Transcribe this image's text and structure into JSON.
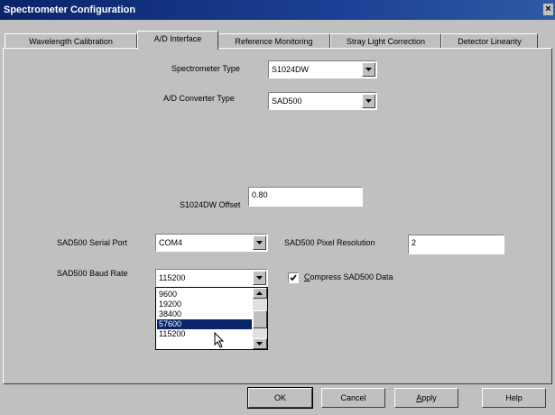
{
  "window": {
    "title": "Spectrometer Configuration",
    "close_glyph": "×"
  },
  "tabs": [
    {
      "label": "Wavelength Calibration",
      "active": false
    },
    {
      "label": "A/D Interface",
      "active": true
    },
    {
      "label": "Reference Monitoring",
      "active": false
    },
    {
      "label": "Stray Light Correction",
      "active": false
    },
    {
      "label": "Detector Linearity",
      "active": false
    }
  ],
  "form": {
    "spectrometer_type": {
      "label": "Spectrometer Type",
      "value": "S1024DW"
    },
    "ad_converter_type": {
      "label": "A/D Converter Type",
      "value": "SAD500"
    },
    "offset": {
      "label": "S1024DW Offset",
      "value": "0.80"
    },
    "serial_port": {
      "label": "SAD500 Serial Port",
      "value": "COM4"
    },
    "pixel_resolution": {
      "label": "SAD500 Pixel Resolution",
      "value": "2"
    },
    "baud_rate": {
      "label": "SAD500 Baud Rate",
      "value": "115200",
      "options": [
        "9600",
        "19200",
        "38400",
        "57600",
        "115200"
      ],
      "highlighted_index": 3
    },
    "compress": {
      "label_prefix": "",
      "label_underlined": "C",
      "label_rest": "ompress SAD500 Data",
      "checked": true
    }
  },
  "buttons": {
    "ok": "OK",
    "cancel": "Cancel",
    "apply_underlined": "A",
    "apply_rest": "pply",
    "help": "Help"
  },
  "colors": {
    "title_bar": "#0a246a",
    "face": "#c0c0c0",
    "selection": "#0a246a"
  }
}
